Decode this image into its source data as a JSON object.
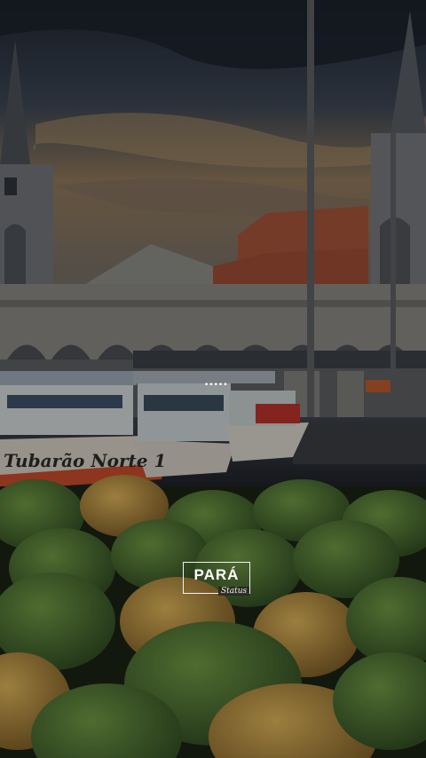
{
  "scene": {
    "boat_name": "Tubarão Norte 1",
    "sky_color": "#2b3442",
    "sunset_color": "#9a7f5c",
    "building_color": "#8f8f8a",
    "roof_color": "#a3523a",
    "hull_color": "#d9d4c8",
    "fruit_green": "#4f7a36",
    "fruit_yellow": "#c7a24a"
  },
  "overlay": {
    "story_dots": "•••••",
    "logo_main": "PARÁ",
    "logo_sub": "Status"
  }
}
